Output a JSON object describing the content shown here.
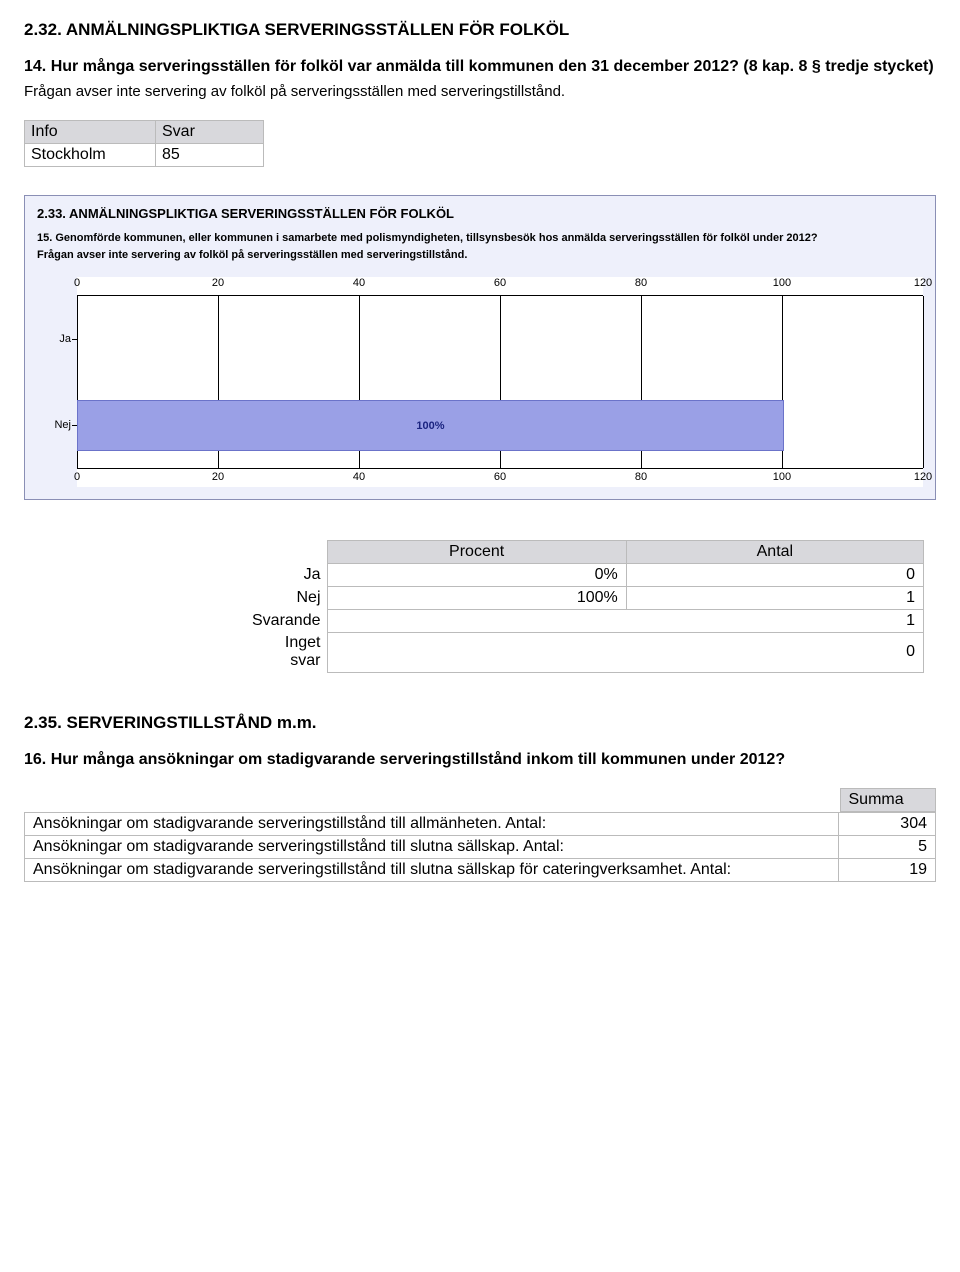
{
  "s232": {
    "title": "2.32. ANMÄLNINGSPLIKTIGA SERVERINGSSTÄLLEN FÖR FOLKÖL",
    "question": "14. Hur många serveringsställen för folköl var anmälda till kommunen den 31 december 2012? (8 kap. 8 § tredje stycket)",
    "note": "Frågan avser inte servering av folköl på serveringsställen med serveringstillstånd.",
    "info_head_left": "Info",
    "info_head_right": "Svar",
    "info_row_left": "Stockholm",
    "info_row_right": "85"
  },
  "panel": {
    "title": "2.33. ANMÄLNINGSPLIKTIGA SERVERINGSSTÄLLEN FÖR FOLKÖL",
    "q_line": "15. Genomförde kommunen, eller kommunen i samarbete med polismyndigheten, tillsynsbesök hos anmälda serveringsställen för folköl under 2012?",
    "note": "Frågan avser inte servering av folköl på serveringsställen med serveringstillstånd.",
    "ticks": {
      "t0": "0",
      "t1": "20",
      "t2": "40",
      "t3": "60",
      "t4": "80",
      "t5": "100",
      "t6": "120"
    },
    "rows": {
      "ja": "Ja",
      "nej": "Nej"
    },
    "bar_label": "100%"
  },
  "results": {
    "h_procent": "Procent",
    "h_antal": "Antal",
    "ja_label": "Ja",
    "ja_pct": "0%",
    "ja_n": "0",
    "nej_label": "Nej",
    "nej_pct": "100%",
    "nej_n": "1",
    "svarande_label": "Svarande",
    "svarande_n": "1",
    "inget_label": "Inget svar",
    "inget_n": "0"
  },
  "s235": {
    "title": "2.35. SERVERINGSTILLSTÅND m.m.",
    "question": "16. Hur många ansökningar om stadigvarande serveringstillstånd inkom till kommunen under 2012?",
    "summa": "Summa",
    "rows": {
      "r1_desc": "Ansökningar om stadigvarande serveringstillstånd till allmänheten. Antal:",
      "r1_val": "304",
      "r2_desc": "Ansökningar om stadigvarande serveringstillstånd till slutna sällskap. Antal:",
      "r2_val": "5",
      "r3_desc": "Ansökningar om stadigvarande serveringstillstånd till slutna sällskap för cateringverksamhet. Antal:",
      "r3_val": "19"
    }
  },
  "chart_data": {
    "type": "bar",
    "orientation": "horizontal",
    "categories": [
      "Ja",
      "Nej"
    ],
    "values": [
      0,
      100
    ],
    "xlim": [
      0,
      120
    ],
    "xlabel": "",
    "ylabel": "",
    "title": "2.33. ANMÄLNINGSPLIKTIGA SERVERINGSSTÄLLEN FÖR FOLKÖL",
    "data_labels": [
      "",
      "100%"
    ]
  }
}
